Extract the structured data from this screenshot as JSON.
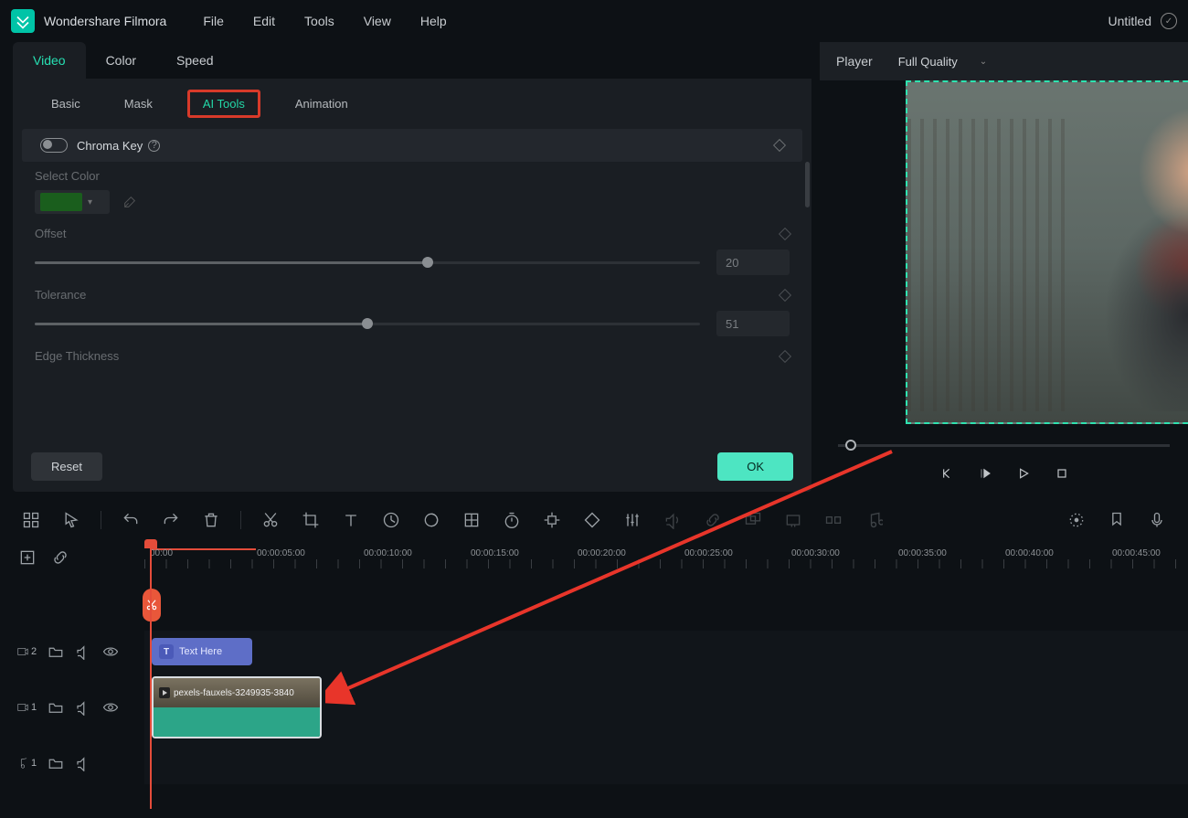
{
  "menubar": {
    "app_title": "Wondershare Filmora",
    "items": [
      "File",
      "Edit",
      "Tools",
      "View",
      "Help"
    ],
    "project": "Untitled"
  },
  "top_tabs": [
    "Video",
    "Color",
    "Speed"
  ],
  "top_tab_active": 0,
  "sub_tabs": [
    "Basic",
    "Mask",
    "AI Tools",
    "Animation"
  ],
  "sub_tab_highlighted": 2,
  "chroma": {
    "section_label": "Chroma Key",
    "select_color_label": "Select Color",
    "color": "#1a8a1a",
    "offset_label": "Offset",
    "offset_value": "20",
    "offset_pct": 59,
    "tolerance_label": "Tolerance",
    "tolerance_value": "51",
    "tolerance_pct": 50,
    "edge_label": "Edge Thickness"
  },
  "footer": {
    "reset": "Reset",
    "ok": "OK"
  },
  "player": {
    "label": "Player",
    "quality": "Full Quality"
  },
  "timeline": {
    "time_markers": [
      "00:00",
      "00:00:05:00",
      "00:00:10:00",
      "00:00:15:00",
      "00:00:20:00",
      "00:00:25:00",
      "00:00:30:00",
      "00:00:35:00",
      "00:00:40:00",
      "00:00:45:00"
    ],
    "text_clip_label": "Text Here",
    "video_clip_label": "pexels-fauxels-3249935-3840",
    "track_video2_label": "2",
    "track_video1_label": "1",
    "track_audio1_label": "1"
  }
}
